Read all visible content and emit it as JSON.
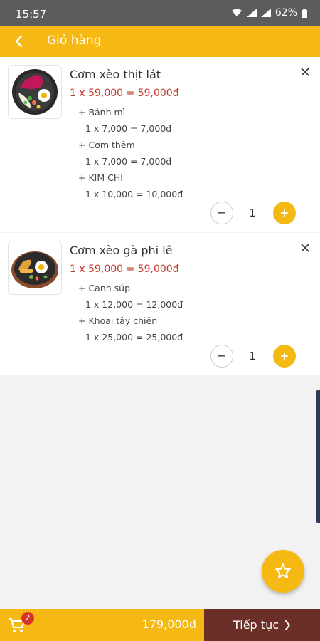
{
  "status_bar": {
    "time": "15:57",
    "battery": "62%"
  },
  "header": {
    "title": "Giỏ hàng"
  },
  "cart_items": [
    {
      "name": "Cơm xèo thịt lát",
      "price_line": "1 x 59,000 = 59,000đ",
      "options": [
        {
          "name": "+ Bánh mì",
          "line": "1 x 7,000 = 7,000đ"
        },
        {
          "name": "+ Cơm thêm",
          "line": "1 x 7,000 = 7,000đ"
        },
        {
          "name": "+ KIM CHI",
          "line": "1 x 10,000 = 10,000đ"
        }
      ],
      "quantity": "1"
    },
    {
      "name": "Cơm xèo gà phi lê",
      "price_line": "1 x 59,000 = 59,000đ",
      "options": [
        {
          "name": "+ Canh súp",
          "line": "1 x 12,000 = 12,000đ"
        },
        {
          "name": "+ Khoai tây chiên",
          "line": "1 x 25,000 = 25,000đ"
        }
      ],
      "quantity": "1"
    }
  ],
  "footer": {
    "cart_badge": "2",
    "total": "179,000đ",
    "continue_label": "Tiếp tục"
  },
  "icons": {
    "back": "back-arrow-icon",
    "close": "close-icon",
    "minus": "minus-icon",
    "plus": "plus-icon",
    "favorite": "star-icon",
    "cart": "cart-icon",
    "chevron": "chevron-right-icon"
  },
  "colors": {
    "primary": "#f6b914",
    "price": "#c0392b",
    "continue_bg": "#6b2f27",
    "badge": "#d9342b"
  }
}
